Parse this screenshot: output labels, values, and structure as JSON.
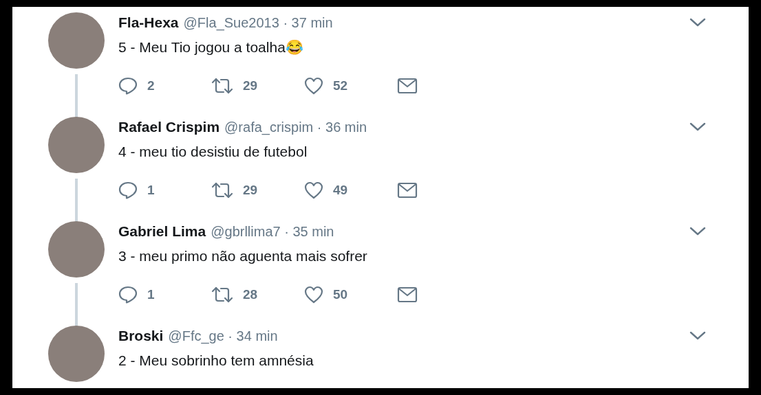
{
  "tweets": [
    {
      "name": "Fla-Hexa",
      "handle_time": "@Fla_Sue2013 · 37 min",
      "text": "5 - Meu Tio jogou a toalha😂",
      "actions": {
        "replies": "2",
        "retweets": "29",
        "likes": "52"
      }
    },
    {
      "name": "Rafael Crispim",
      "handle_time": "@rafa_crispim · 36 min",
      "text": "4 - meu tio desistiu de futebol",
      "actions": {
        "replies": "1",
        "retweets": "29",
        "likes": "49"
      }
    },
    {
      "name": "Gabriel Lima",
      "handle_time": "@gbrllima7 · 35 min",
      "text": "3 - meu primo não aguenta mais sofrer",
      "actions": {
        "replies": "1",
        "retweets": "28",
        "likes": "50"
      }
    },
    {
      "name": "Broski",
      "handle_time": "@Ffc_ge · 34 min",
      "text": "2 - Meu sobrinho tem amnésia"
    }
  ]
}
